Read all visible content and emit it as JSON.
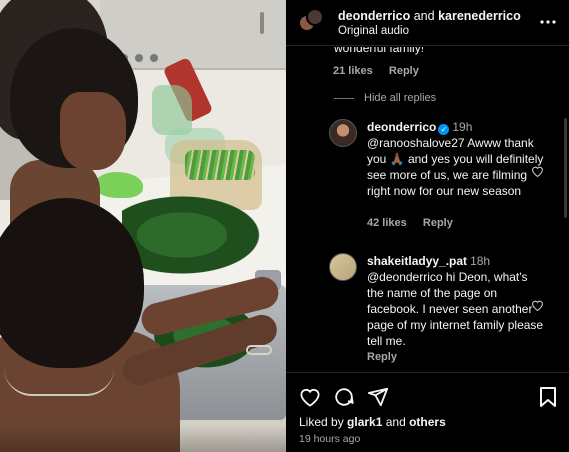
{
  "header": {
    "user1": "deonderrico",
    "and": " and ",
    "user2": "karenederrico",
    "audio": "Original audio",
    "more_icon": "more-horizontal-icon"
  },
  "thread": {
    "clipped_text": "wonderful family!",
    "prev_likes": "21 likes",
    "prev_reply": "Reply",
    "hide_replies": "Hide all replies"
  },
  "comments": [
    {
      "username": "deonderrico",
      "verified": true,
      "time": "19h",
      "text": "@ranooshalove27 Awww thank you 🙏🏾 and yes you will definitely see more of us, we are filming right now for our new season",
      "likes": "42 likes",
      "reply": "Reply"
    },
    {
      "username": "shakeitladyy_.pat",
      "verified": false,
      "time": "18h",
      "text": "@deonderrico hi Deon, what's the name of the page on facebook. I never seen another page of my internet family please tell me.",
      "likes": "",
      "reply": "Reply"
    }
  ],
  "actions": {
    "like_icon": "heart-icon",
    "comment_icon": "comment-icon",
    "share_icon": "send-icon",
    "save_icon": "bookmark-icon"
  },
  "likes": {
    "prefix": "Liked by ",
    "user": "glark1",
    "middle": " and ",
    "others": "others"
  },
  "timestamp": "19 hours ago",
  "colors": {
    "background": "#000000",
    "text": "#f5f5f5",
    "secondary": "#a8a8a8",
    "verified": "#0095f6"
  }
}
